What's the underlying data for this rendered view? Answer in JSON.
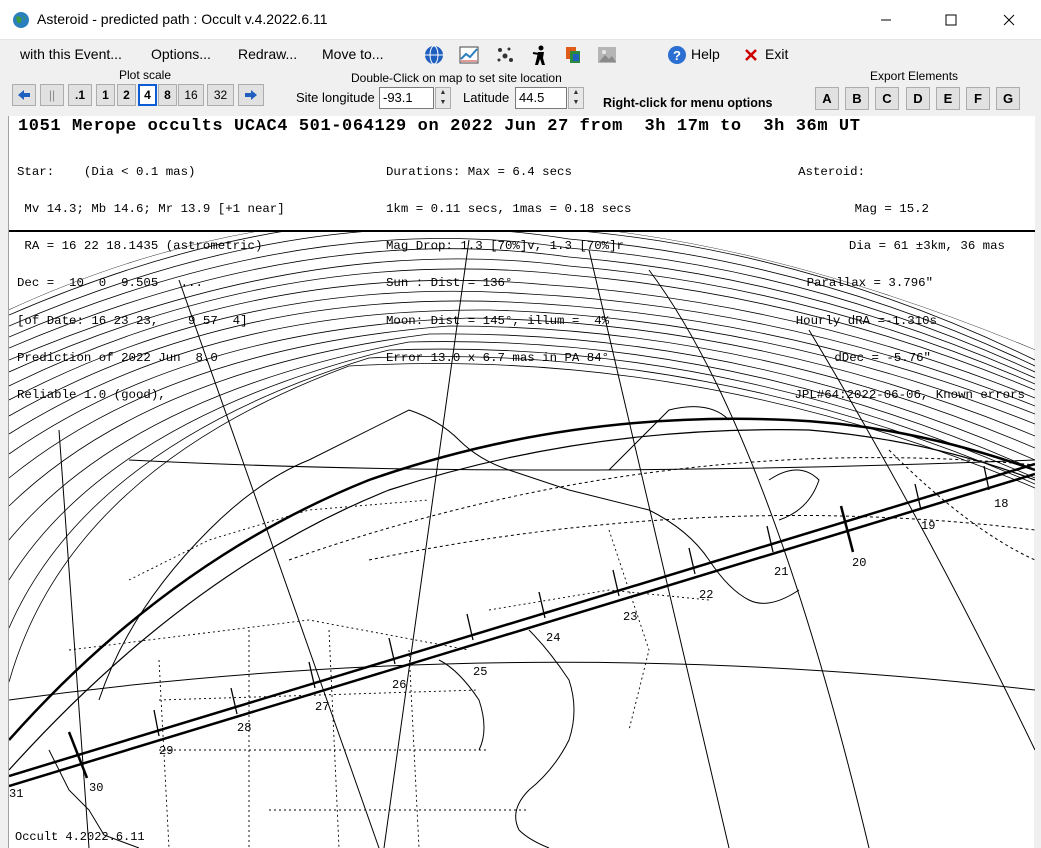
{
  "window": {
    "title": "Asteroid - predicted path : Occult v.4.2022.6.11",
    "minimize": "—",
    "maximize": "☐",
    "close": "✕"
  },
  "menu": {
    "items": [
      "with this Event...",
      "Options...",
      "Redraw...",
      "Move to..."
    ],
    "help": "Help",
    "exit": "Exit"
  },
  "controls": {
    "plot_scale_label": "Plot scale",
    "scale_buttons": [
      ".1",
      "1",
      "2",
      "4",
      "8",
      "16",
      "32"
    ],
    "active_scale": "4",
    "pause_label": "||",
    "double_click_hint": "Double-Click on map to set site location",
    "site_longitude_label": "Site longitude",
    "site_longitude_value": "-93.1",
    "latitude_label": "Latitude",
    "latitude_value": "44.5",
    "right_click_hint": "Right-click for menu options",
    "export_label": "Export Elements",
    "export_buttons": [
      "A",
      "B",
      "C",
      "D",
      "E",
      "F",
      "G"
    ]
  },
  "info": {
    "headline": "1051 Merope occults UCAC4 501-064129 on 2022 Jun 27 from  3h 17m to  3h 36m UT",
    "star_lines": [
      "Star:    (Dia < 0.1 mas)",
      " Mv 14.3; Mb 14.6; Mr 13.9 [+1 near]",
      " RA = 16 22 18.1435 (astrometric)",
      "Dec =  10  0  9.505   ...",
      "[of Date: 16 23 23,    9 57  4]",
      "Prediction of 2022 Jun  8.0",
      "Reliable 1.0 (good),"
    ],
    "duration_lines": [
      "Durations: Max = 6.4 secs",
      "1km = 0.11 secs, 1mas = 0.18 secs",
      "Mag Drop: 1.3 [70%]v, 1.3 [70%]r",
      "Sun : Dist = 136°",
      "Moon: Dist = 145°, illum =  4%",
      "Error 13.0 x 6.7 mas in PA 84°"
    ],
    "asteroid_lines": [
      "Asteroid:",
      "Mag = 15.2",
      "Dia = 61 ±3km, 36 mas",
      "Parallax = 3.796\"",
      "Hourly dRA =-1.310s",
      "dDec = -5.76\"",
      "JPL#64:2022-06-06, Known errors"
    ]
  },
  "map": {
    "time_ticks": [
      "31",
      "30",
      "29",
      "28",
      "27",
      "26",
      "25",
      "24",
      "23",
      "22",
      "21",
      "20",
      "19",
      "18"
    ],
    "footer": "Occult 4.2022.6.11"
  },
  "colors": {
    "title_bg": "#ffffff",
    "active_scale_border": "#0b5cd5",
    "exit_x": "#cc0000"
  }
}
